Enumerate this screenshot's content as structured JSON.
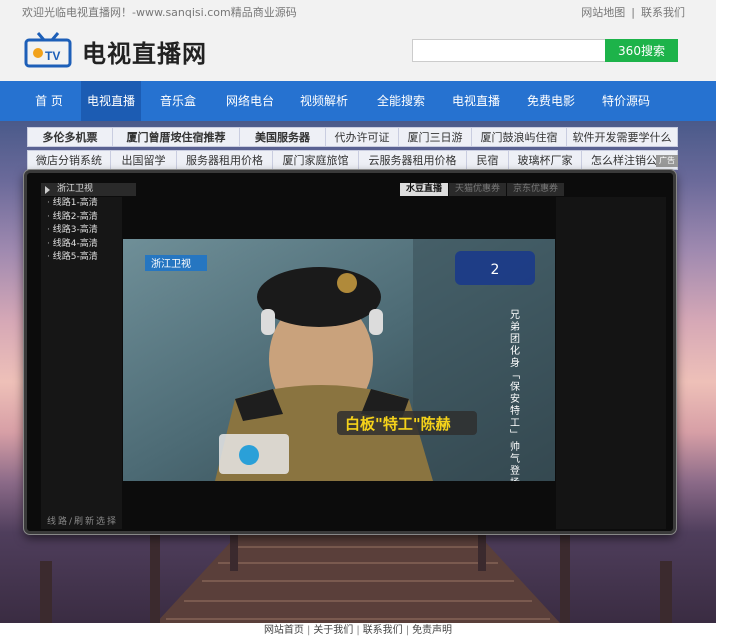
{
  "topbar": {
    "welcome": "欢迎光临电视直播网！-www.sanqisi.com精品商业源码",
    "links": [
      "网站地图",
      "联系我们"
    ]
  },
  "header": {
    "logo_text": "电视直播网",
    "logo_badge": "TV",
    "search_placeholder": "",
    "search_button": "360搜索"
  },
  "nav": {
    "items": [
      {
        "label": "首 页",
        "active": false
      },
      {
        "label": "电视直播",
        "active": true
      },
      {
        "label": "音乐盒",
        "active": false
      },
      {
        "label": "网络电台",
        "active": false
      },
      {
        "label": "视频解析",
        "active": false
      },
      {
        "label": "全能搜索",
        "active": false
      },
      {
        "label": "电视直播",
        "active": false
      },
      {
        "label": "免费电影",
        "active": false
      },
      {
        "label": "特价源码",
        "active": false
      }
    ]
  },
  "tags": {
    "row1": [
      "多伦多机票",
      "厦门曾厝垵住宿推荐",
      "美国服务器",
      "代办许可证",
      "厦门三日游",
      "厦门鼓浪屿住宿",
      "软件开发需要学什么"
    ],
    "row2": [
      "微店分销系统",
      "出国留学",
      "服务器租用价格",
      "厦门家庭旅馆",
      "云服务器租用价格",
      "民宿",
      "玻璃杯厂家",
      "怎么样注销公司"
    ],
    "ad_badge": "广告"
  },
  "player": {
    "channel_name": "浙江卫视",
    "lines": [
      "线路1-高清",
      "线路2-高清",
      "线路3-高清",
      "线路4-高清",
      "线路5-高清"
    ],
    "source_tabs": [
      "水豆直播",
      "天猫优惠券",
      "京东优惠券"
    ],
    "footer_note": "线路/刷新选择",
    "video_caption": "白板\"特工\"陈赫",
    "video_side_text": "兄弟团化身「保安特工」帅气登场执行神秘任务",
    "video_logo": "浙江卫视"
  },
  "footer": {
    "links": [
      "网站首页",
      "关于我们",
      "联系我们",
      "免责声明"
    ]
  },
  "colors": {
    "nav_bg": "#2672d0",
    "nav_active": "#1c5cb3",
    "search_button": "#1db34a"
  }
}
